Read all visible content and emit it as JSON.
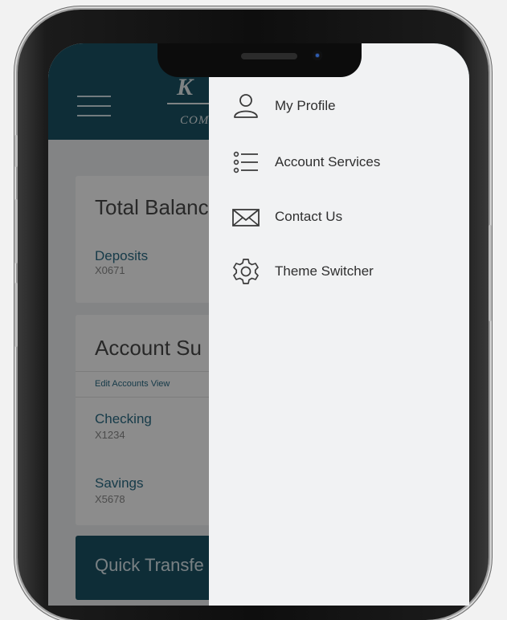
{
  "app": {
    "logo_text": "K",
    "logo_sub": "COM",
    "total_balance_title": "Total Balanc",
    "deposits": {
      "name": "Deposits",
      "number": "X0671"
    },
    "account_summary_title": "Account Su",
    "edit_accounts_label": "Edit Accounts View",
    "accounts": [
      {
        "name": "Checking",
        "number": "X1234"
      },
      {
        "name": "Savings",
        "number": "X5678"
      }
    ],
    "quick_transfer_label": "Quick Transfe"
  },
  "menu": {
    "items": [
      {
        "label": "My Profile",
        "icon": "user-icon"
      },
      {
        "label": "Account Services",
        "icon": "list-icon"
      },
      {
        "label": "Contact Us",
        "icon": "envelope-icon"
      },
      {
        "label": "Theme Switcher",
        "icon": "gear-icon"
      }
    ]
  },
  "colors": {
    "header": "#1b5264",
    "drawer": "#f1f2f3",
    "link": "#2a6c86"
  }
}
